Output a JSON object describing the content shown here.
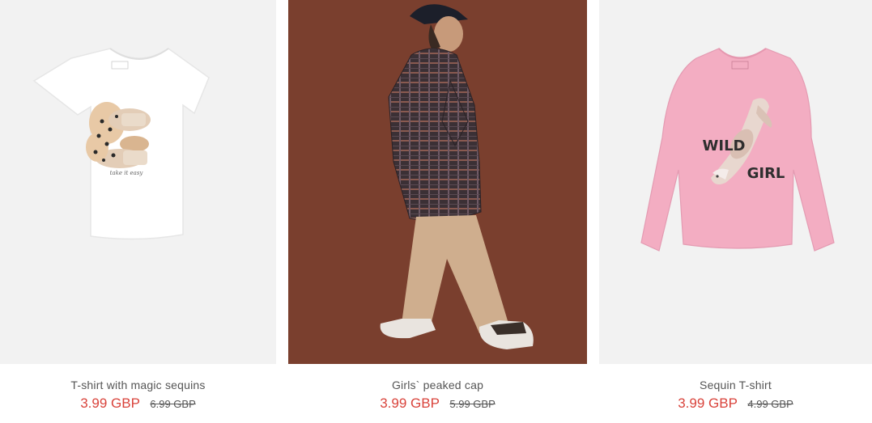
{
  "colors": {
    "sale_price": "#d9433b",
    "text": "#555555",
    "photo_bg_light": "#f2f2f2",
    "photo_bg_brown": "#7a3f2e"
  },
  "products": [
    {
      "name": "T-shirt with magic sequins",
      "price_current": "3.99 GBP",
      "price_original": "6.99 GBP",
      "image_icon": "white-tshirt-leopard-sequins-image"
    },
    {
      "name": "Girls` peaked cap",
      "price_current": "3.99 GBP",
      "price_original": "5.99 GBP",
      "image_icon": "girl-in-plaid-coat-and-cap-image"
    },
    {
      "name": "Sequin T-shirt",
      "price_current": "3.99 GBP",
      "price_original": "4.99 GBP",
      "image_icon": "pink-longsleeve-wild-girl-image"
    }
  ],
  "print_text": {
    "wild": "WILD",
    "girl": "GIRL",
    "script": "take it easy"
  }
}
